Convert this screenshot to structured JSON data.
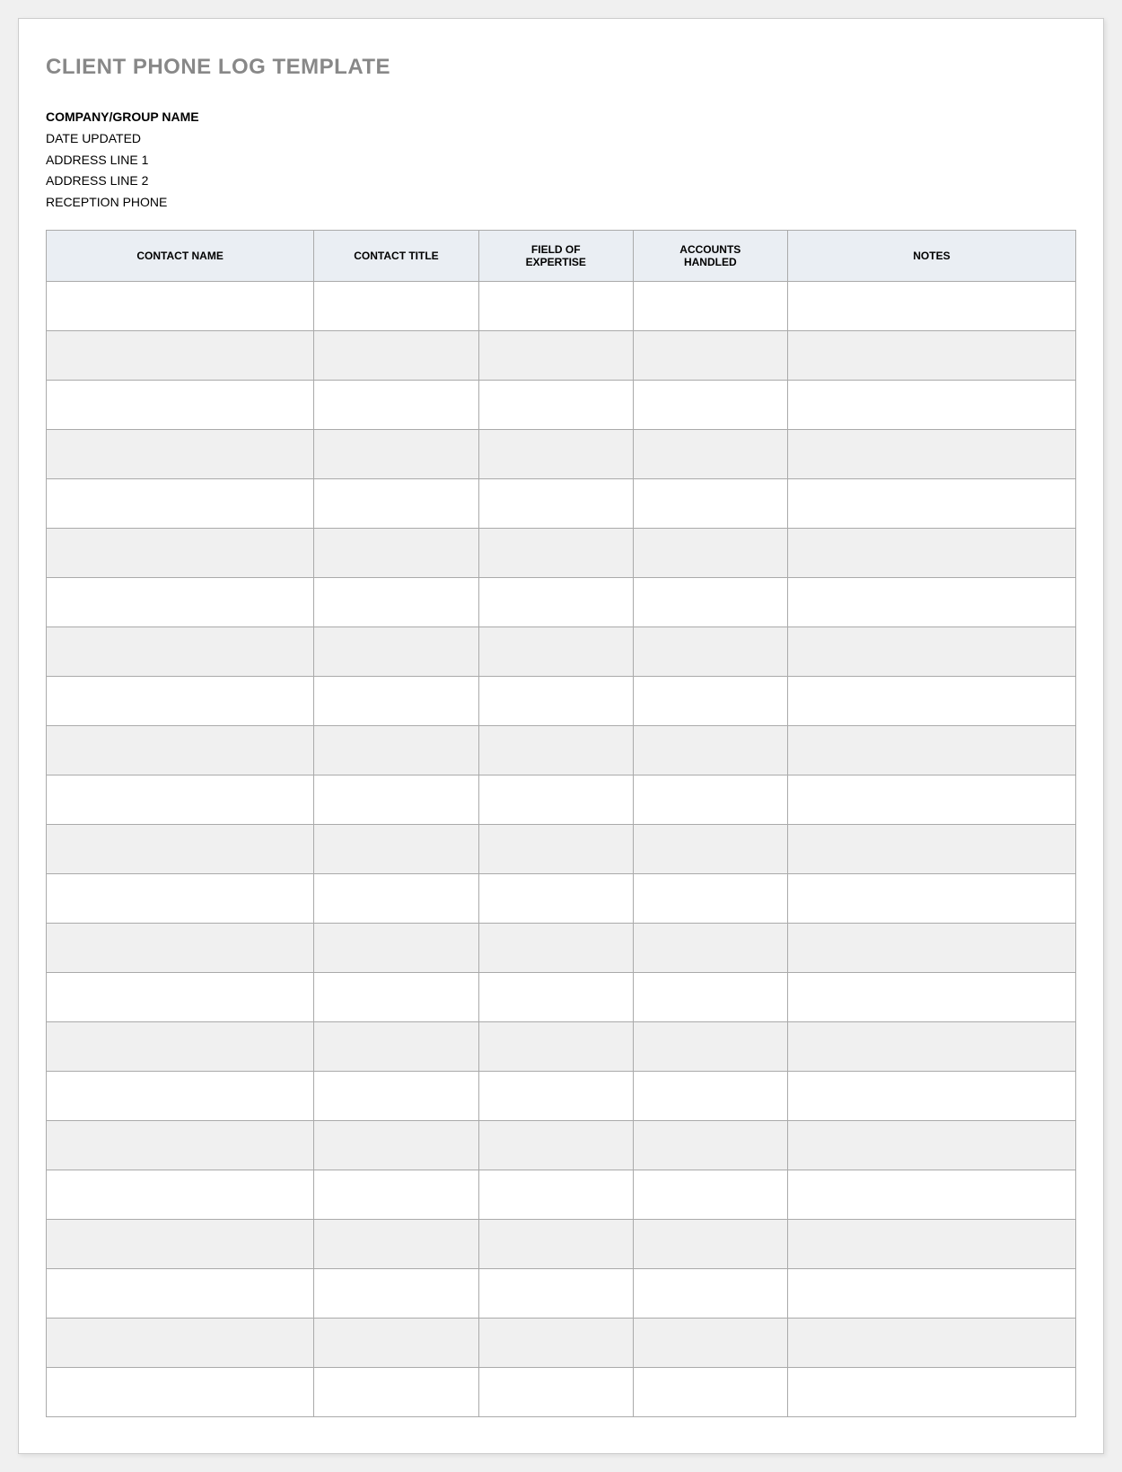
{
  "title": "CLIENT PHONE LOG TEMPLATE",
  "company": {
    "name": "COMPANY/GROUP NAME",
    "date_updated": "DATE UPDATED",
    "address_line_1": "ADDRESS LINE 1",
    "address_line_2": "ADDRESS LINE 2",
    "reception_phone": "RECEPTION PHONE"
  },
  "table": {
    "headers": {
      "contact_name": "CONTACT NAME",
      "contact_title": "CONTACT TITLE",
      "field_of_expertise": "FIELD OF\nEXPERTISE",
      "accounts_handled": "ACCOUNTS\nHANDLED",
      "notes": "NOTES"
    },
    "rows": [
      {
        "contact_name": "",
        "contact_title": "",
        "field_of_expertise": "",
        "accounts_handled": "",
        "notes": ""
      },
      {
        "contact_name": "",
        "contact_title": "",
        "field_of_expertise": "",
        "accounts_handled": "",
        "notes": ""
      },
      {
        "contact_name": "",
        "contact_title": "",
        "field_of_expertise": "",
        "accounts_handled": "",
        "notes": ""
      },
      {
        "contact_name": "",
        "contact_title": "",
        "field_of_expertise": "",
        "accounts_handled": "",
        "notes": ""
      },
      {
        "contact_name": "",
        "contact_title": "",
        "field_of_expertise": "",
        "accounts_handled": "",
        "notes": ""
      },
      {
        "contact_name": "",
        "contact_title": "",
        "field_of_expertise": "",
        "accounts_handled": "",
        "notes": ""
      },
      {
        "contact_name": "",
        "contact_title": "",
        "field_of_expertise": "",
        "accounts_handled": "",
        "notes": ""
      },
      {
        "contact_name": "",
        "contact_title": "",
        "field_of_expertise": "",
        "accounts_handled": "",
        "notes": ""
      },
      {
        "contact_name": "",
        "contact_title": "",
        "field_of_expertise": "",
        "accounts_handled": "",
        "notes": ""
      },
      {
        "contact_name": "",
        "contact_title": "",
        "field_of_expertise": "",
        "accounts_handled": "",
        "notes": ""
      },
      {
        "contact_name": "",
        "contact_title": "",
        "field_of_expertise": "",
        "accounts_handled": "",
        "notes": ""
      },
      {
        "contact_name": "",
        "contact_title": "",
        "field_of_expertise": "",
        "accounts_handled": "",
        "notes": ""
      },
      {
        "contact_name": "",
        "contact_title": "",
        "field_of_expertise": "",
        "accounts_handled": "",
        "notes": ""
      },
      {
        "contact_name": "",
        "contact_title": "",
        "field_of_expertise": "",
        "accounts_handled": "",
        "notes": ""
      },
      {
        "contact_name": "",
        "contact_title": "",
        "field_of_expertise": "",
        "accounts_handled": "",
        "notes": ""
      },
      {
        "contact_name": "",
        "contact_title": "",
        "field_of_expertise": "",
        "accounts_handled": "",
        "notes": ""
      },
      {
        "contact_name": "",
        "contact_title": "",
        "field_of_expertise": "",
        "accounts_handled": "",
        "notes": ""
      },
      {
        "contact_name": "",
        "contact_title": "",
        "field_of_expertise": "",
        "accounts_handled": "",
        "notes": ""
      },
      {
        "contact_name": "",
        "contact_title": "",
        "field_of_expertise": "",
        "accounts_handled": "",
        "notes": ""
      },
      {
        "contact_name": "",
        "contact_title": "",
        "field_of_expertise": "",
        "accounts_handled": "",
        "notes": ""
      },
      {
        "contact_name": "",
        "contact_title": "",
        "field_of_expertise": "",
        "accounts_handled": "",
        "notes": ""
      },
      {
        "contact_name": "",
        "contact_title": "",
        "field_of_expertise": "",
        "accounts_handled": "",
        "notes": ""
      },
      {
        "contact_name": "",
        "contact_title": "",
        "field_of_expertise": "",
        "accounts_handled": "",
        "notes": ""
      }
    ]
  }
}
